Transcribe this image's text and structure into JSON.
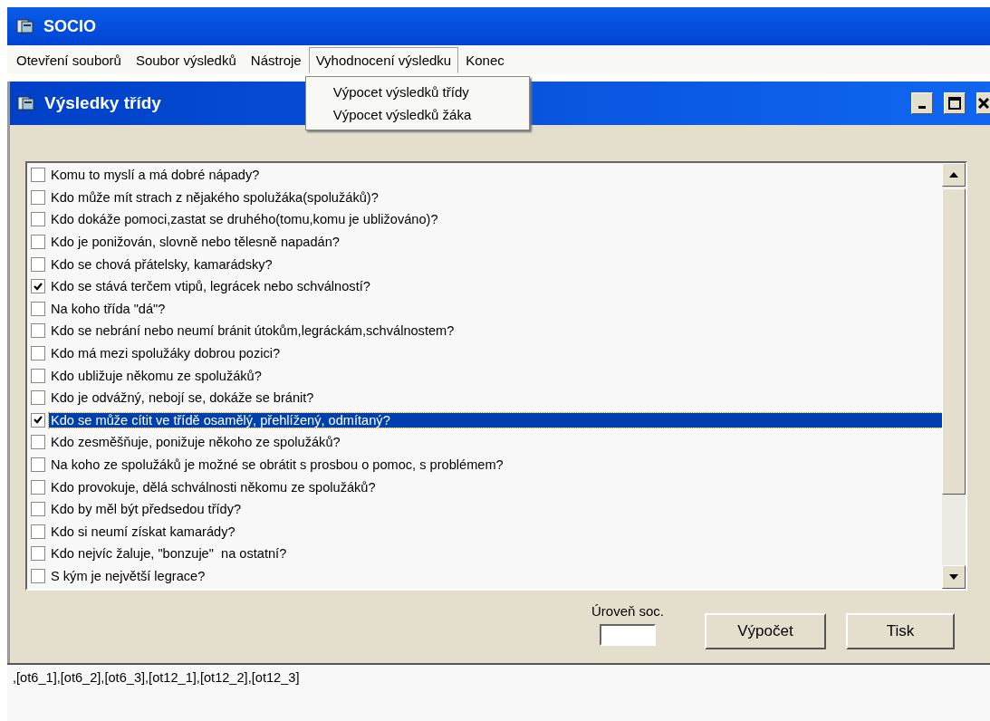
{
  "window": {
    "title": "SOCIO"
  },
  "menu": [
    {
      "label": "Otevření souborů",
      "selected": false
    },
    {
      "label": "Soubor výsledků",
      "selected": false
    },
    {
      "label": "Nástroje",
      "selected": false
    },
    {
      "label": "Vyhodnocení výsledku",
      "selected": true
    },
    {
      "label": "Konec",
      "selected": false
    }
  ],
  "dropdown": [
    "Výpocet výsledků třídy",
    "Výpocet výsledků žáka"
  ],
  "child_window": {
    "title": "Výsledky třídy"
  },
  "questions": [
    {
      "text": "Komu to myslí a má dobré nápady?",
      "checked": false,
      "selected": false
    },
    {
      "text": "Kdo může mít strach z nějakého spolužáka(spolužáků)?",
      "checked": false,
      "selected": false
    },
    {
      "text": "Kdo dokáže pomoci,zastat se druhého(tomu,komu je ubližováno)?",
      "checked": false,
      "selected": false
    },
    {
      "text": "Kdo je ponižován, slovně nebo tělesně napadán?",
      "checked": false,
      "selected": false
    },
    {
      "text": "Kdo se chová přátelsky, kamarádsky?",
      "checked": false,
      "selected": false
    },
    {
      "text": "Kdo se stává terčem vtipů, legrácek nebo schválností?",
      "checked": true,
      "selected": false
    },
    {
      "text": "Na koho třída \"dá\"?",
      "checked": false,
      "selected": false
    },
    {
      "text": "Kdo se nebrání nebo neumí bránit útokům,legráckám,schválnostem?",
      "checked": false,
      "selected": false
    },
    {
      "text": "Kdo má mezi spolužáky dobrou pozici?",
      "checked": false,
      "selected": false
    },
    {
      "text": "Kdo ubližuje někomu ze spolužáků?",
      "checked": false,
      "selected": false
    },
    {
      "text": "Kdo je odvážný, nebojí se, dokáže se bránit?",
      "checked": false,
      "selected": false
    },
    {
      "text": "Kdo se může cítit ve třídě osamělý, přehlížený, odmítaný?",
      "checked": true,
      "selected": true
    },
    {
      "text": "Kdo zesměšňuje, ponižuje někoho ze spolužáků?",
      "checked": false,
      "selected": false
    },
    {
      "text": "Na koho ze spolužáků je možné se obrátit s prosbou o pomoc, s problémem?",
      "checked": false,
      "selected": false
    },
    {
      "text": "Kdo provokuje, dělá schválnosti někomu ze spolužáků?",
      "checked": false,
      "selected": false
    },
    {
      "text": "Kdo by měl být předsedou třídy?",
      "checked": false,
      "selected": false
    },
    {
      "text": "Kdo si neumí získat kamarády?",
      "checked": false,
      "selected": false
    },
    {
      "text": "Kdo nejvíc žaluje, \"bonzuje\"  na ostatní?",
      "checked": false,
      "selected": false
    },
    {
      "text": "S kým je největší legrace?",
      "checked": false,
      "selected": false
    }
  ],
  "level": {
    "label": "Úroveň soc."
  },
  "buttons": [
    "Výpočet",
    "Tisk"
  ],
  "output": ",[ot6_1],[ot6_2],[ot6_3],[ot12_1],[ot12_2],[ot12_3]"
}
